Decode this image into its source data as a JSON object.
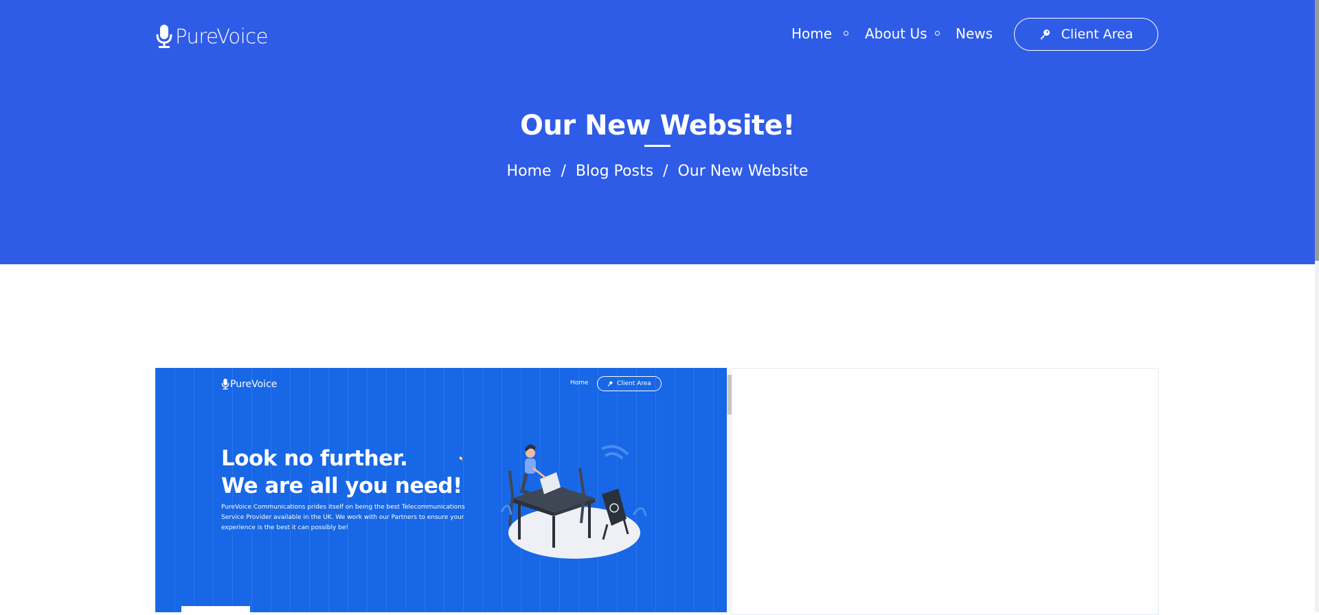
{
  "header": {
    "logo_text": "PureVoice",
    "nav": [
      "Home",
      "About Us",
      "News"
    ],
    "client_button": "Client Area"
  },
  "hero": {
    "title": "Our New Website!",
    "breadcrumb": [
      "Home",
      "Blog Posts",
      "Our New Website"
    ]
  },
  "preview": {
    "logo_text": "PureVoice",
    "nav_home": "Home",
    "client_button": "Client Area",
    "headline_line1": "Look no further.",
    "headline_line2": "We are all you need!",
    "paragraph": "PureVoice Communications prides itself on being the best Telecommunications Service Provider available in the UK. We work with our Partners to ensure your experience is the best it can possibly be!"
  },
  "colors": {
    "hero_blue": "#2f5ce6",
    "preview_blue": "#1767e6",
    "text_white": "#ffffff"
  },
  "icons": [
    "microphone-icon",
    "key-icon"
  ]
}
